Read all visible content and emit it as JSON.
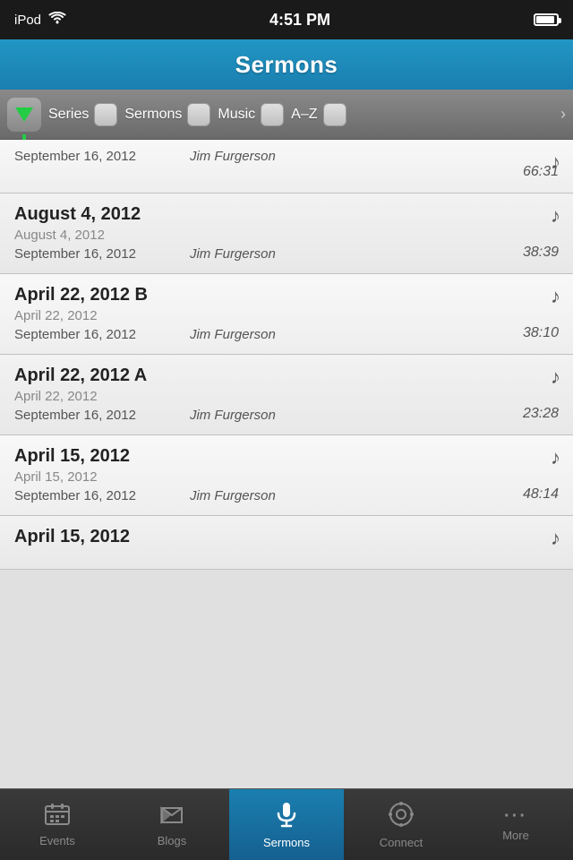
{
  "statusBar": {
    "device": "iPod",
    "time": "4:51 PM"
  },
  "header": {
    "title": "Sermons"
  },
  "filterBar": {
    "tabs": [
      {
        "label": "Series"
      },
      {
        "label": "Sermons"
      },
      {
        "label": "Music"
      },
      {
        "label": "A–Z"
      }
    ]
  },
  "sermons": [
    {
      "title": "",
      "hasTitle": false,
      "dateDisplay": "",
      "seriesDate": "September 16, 2012",
      "speaker": "Jim Furgerson",
      "duration": "66:31",
      "hasMusic": true
    },
    {
      "title": "August 4, 2012",
      "dateDisplay": "August 4, 2012",
      "seriesDate": "September 16, 2012",
      "speaker": "Jim Furgerson",
      "duration": "38:39",
      "hasMusic": true
    },
    {
      "title": "April 22, 2012 B",
      "dateDisplay": "April 22, 2012",
      "seriesDate": "September 16, 2012",
      "speaker": "Jim Furgerson",
      "duration": "38:10",
      "hasMusic": true
    },
    {
      "title": "April 22, 2012 A",
      "dateDisplay": "April 22, 2012",
      "seriesDate": "September 16, 2012",
      "speaker": "Jim Furgerson",
      "duration": "23:28",
      "hasMusic": true
    },
    {
      "title": "April 15, 2012",
      "dateDisplay": "April 15, 2012",
      "seriesDate": "September 16, 2012",
      "speaker": "Jim Furgerson",
      "duration": "48:14",
      "hasMusic": true
    },
    {
      "title": "April 15, 2012",
      "dateDisplay": "",
      "seriesDate": "",
      "speaker": "",
      "duration": "",
      "hasMusic": true,
      "partial": true
    }
  ],
  "tabBar": {
    "tabs": [
      {
        "label": "Events",
        "icon": "📅",
        "active": false
      },
      {
        "label": "Blogs",
        "icon": "📢",
        "active": false
      },
      {
        "label": "Sermons",
        "icon": "🎤",
        "active": true
      },
      {
        "label": "Connect",
        "icon": "⚙️",
        "active": false
      },
      {
        "label": "More",
        "icon": "···",
        "active": false
      }
    ]
  }
}
